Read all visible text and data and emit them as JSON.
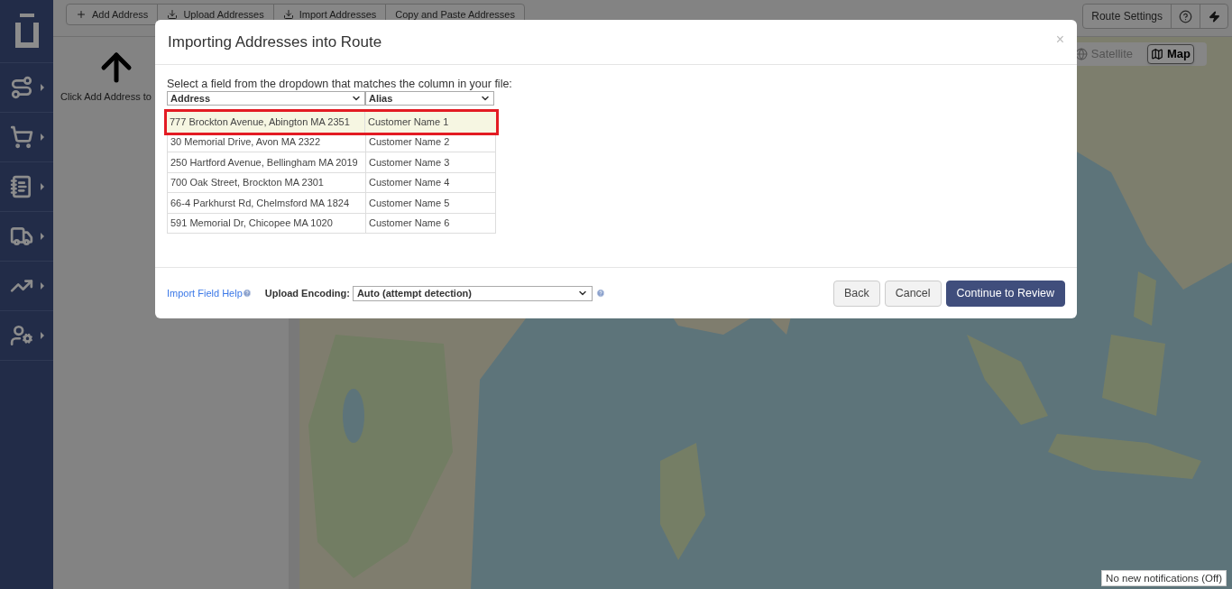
{
  "toolbar": {
    "buttons": [
      {
        "label": "Add Address"
      },
      {
        "label": "Upload Addresses"
      },
      {
        "label": "Import Addresses"
      },
      {
        "label": "Copy and Paste Addresses"
      }
    ],
    "route_settings": "Route Settings"
  },
  "left_panel": {
    "hint": "Click Add Address to"
  },
  "map_type": [
    {
      "label": "Satellite",
      "selected": false
    },
    {
      "label": "Map",
      "selected": true
    }
  ],
  "modal": {
    "title": "Importing Addresses into Route",
    "close": "×",
    "instruction": "Select a field from the dropdown that matches the column in your file:",
    "columns": [
      {
        "label": "Address"
      },
      {
        "label": "Alias"
      }
    ],
    "rows": [
      {
        "cells": [
          "777 Brockton Avenue, Abington MA 2351",
          "Customer Name 1"
        ],
        "selected": true
      },
      {
        "cells": [
          "30 Memorial Drive, Avon MA 2322",
          "Customer Name 2"
        ],
        "selected": false
      },
      {
        "cells": [
          "250 Hartford Avenue, Bellingham MA 2019",
          "Customer Name 3"
        ],
        "selected": false
      },
      {
        "cells": [
          "700 Oak Street, Brockton MA 2301",
          "Customer Name 4"
        ],
        "selected": false
      },
      {
        "cells": [
          "66-4 Parkhurst Rd, Chelmsford MA 1824",
          "Customer Name 5"
        ],
        "selected": false
      },
      {
        "cells": [
          "591 Memorial Dr, Chicopee MA 1020",
          "Customer Name 6"
        ],
        "selected": false
      }
    ],
    "help_link": "Import Field Help",
    "encoding_label": "Upload Encoding:",
    "encoding_value": "Auto (attempt detection)",
    "buttons": [
      {
        "label": "Back",
        "kind": "default"
      },
      {
        "label": "Cancel",
        "kind": "default"
      },
      {
        "label": "Continue to Review",
        "kind": "primary"
      }
    ]
  },
  "notification": "No new notifications (Off)"
}
